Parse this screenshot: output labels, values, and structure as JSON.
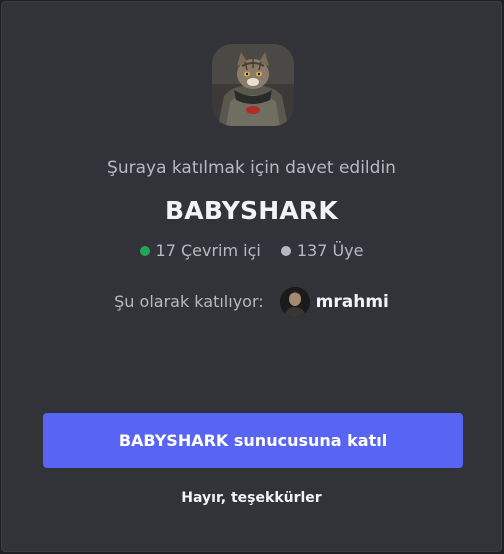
{
  "invite": {
    "heading": "Şuraya katılmak için davet edildin",
    "server_name": "BABYSHARK",
    "server_icon": "cat-in-jacket-image",
    "online_label": "17 Çevrim içi",
    "member_label": "137 Üye",
    "joining_as_label": "Şu olarak katılıyor:",
    "username": "mrahmi",
    "user_avatar": "user-avatar-image",
    "join_button_label": "BABYSHARK sunucusuna katıl",
    "decline_label": "Hayır, teşekkürler"
  },
  "colors": {
    "background": "#313338",
    "online_dot": "#23a55a",
    "member_dot": "#b5bac1",
    "primary_button": "#5865f2",
    "text_muted": "#b5bac1",
    "text_normal": "#f2f3f5"
  }
}
